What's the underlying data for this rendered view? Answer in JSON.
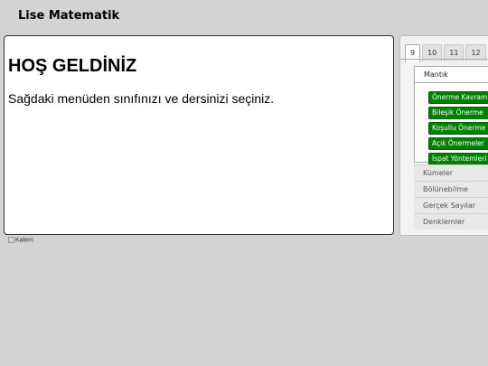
{
  "site": {
    "title": "Lise Matematik"
  },
  "main": {
    "heading": "HOŞ GELDİNİZ",
    "text": "Sağdaki menüden sınıfınızı ve dersinizi seçiniz."
  },
  "broken_image": {
    "alt": "Kalem"
  },
  "sidebar": {
    "tabs": [
      "9",
      "10",
      "11",
      "12"
    ],
    "active_tab": "9",
    "open_section": {
      "label": "Mantık",
      "items": [
        "Önerme Kavramı",
        "Bileşik Önerme",
        "Koşullu Önerme",
        "Açık Önermeler",
        "İspat Yöntemleri"
      ]
    },
    "sections": [
      "Kümeler",
      "Bölünebilme",
      "Gerçek Sayılar",
      "Denklemler"
    ]
  },
  "colors": {
    "item_bg": "#008000",
    "page_bg": "#d3d3d3"
  }
}
